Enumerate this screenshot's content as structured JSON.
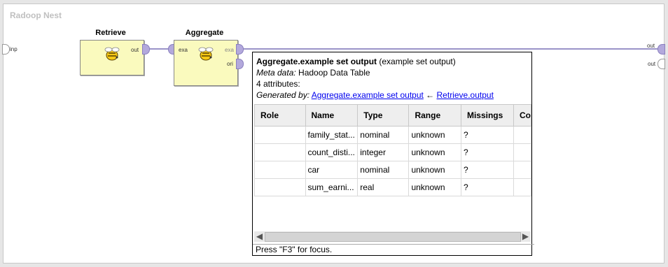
{
  "process": {
    "title": "Radoop Nest",
    "left_port": "inp",
    "right_ports": [
      "out",
      "out"
    ]
  },
  "operators": {
    "retrieve": {
      "name": "Retrieve",
      "out_port": "out"
    },
    "aggregate": {
      "name": "Aggregate",
      "in_port": "exa",
      "out_port_1": "exa",
      "out_port_2": "ori"
    }
  },
  "popup": {
    "title_bold": "Aggregate.example set output",
    "title_rest": " (example set output)",
    "meta_label": "Meta data:",
    "meta_value": " Hadoop Data Table",
    "attributes": "4 attributes:",
    "generated_label": "Generated by:",
    "generated_link1": "Aggregate.example set output",
    "arrow": " ← ",
    "generated_link2": "Retrieve.output",
    "columns": [
      "Role",
      "Name",
      "Type",
      "Range",
      "Missings",
      "Co"
    ],
    "rows": [
      [
        "",
        "family_stat...",
        "nominal",
        "unknown",
        "?",
        ""
      ],
      [
        "",
        "count_disti...",
        "integer",
        "unknown",
        "?",
        ""
      ],
      [
        "",
        "car",
        "nominal",
        "unknown",
        "?",
        ""
      ],
      [
        "",
        "sum_earni...",
        "real",
        "unknown",
        "?",
        ""
      ]
    ],
    "status": "Press \"F3\" for focus."
  },
  "colors": {
    "operator_bg": "#fafabe",
    "port": "#b3a9dc",
    "connection": "#9a93c8"
  }
}
